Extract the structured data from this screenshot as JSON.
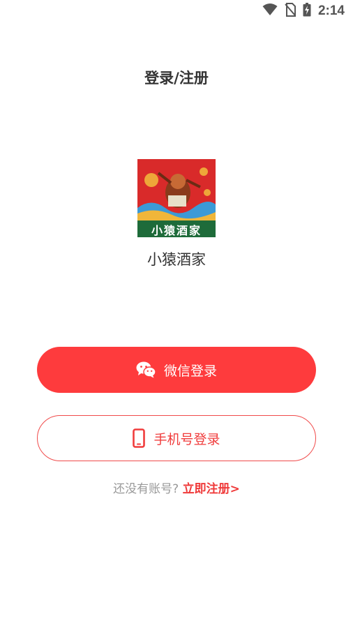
{
  "status_bar": {
    "time": "2:14",
    "icons": [
      "wifi-icon",
      "no-sim-icon",
      "battery-charging-icon"
    ]
  },
  "header": {
    "title": "登录/注册"
  },
  "app": {
    "logo_text": "小猿酒家",
    "name": "小猿酒家"
  },
  "buttons": {
    "wechat_login": "微信登录",
    "phone_login": "手机号登录"
  },
  "register": {
    "prompt": "还没有账号?",
    "link": "立即注册>"
  },
  "colors": {
    "primary_red": "#fe3b3d",
    "logo_green": "#1e6b3a",
    "text_gray": "#999999"
  }
}
